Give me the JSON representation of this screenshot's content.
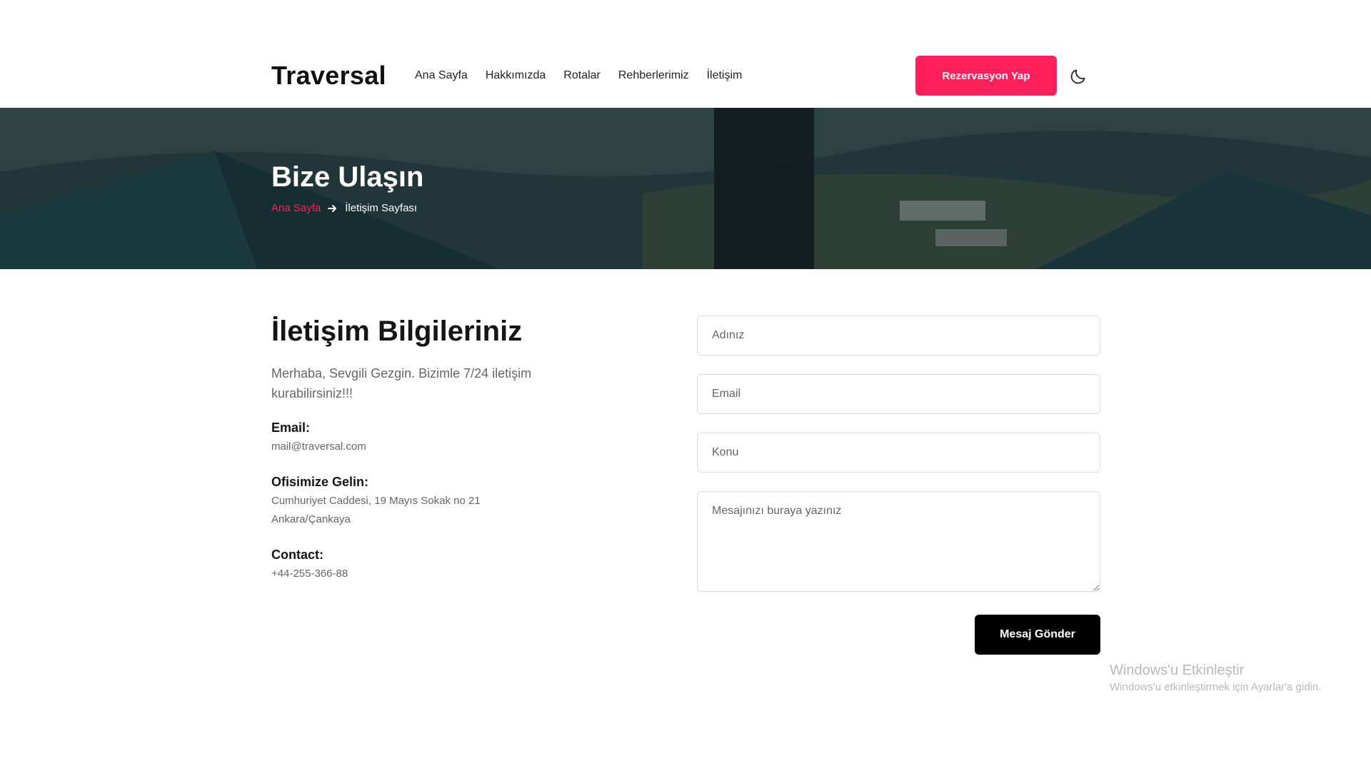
{
  "header": {
    "logo": "Traversal",
    "nav": [
      "Ana Sayfa",
      "Hakkımızda",
      "Rotalar",
      "Rehberlerimiz",
      "İletişim"
    ],
    "reserve_button": "Rezervasyon Yap",
    "theme_icon": "moon-icon"
  },
  "hero": {
    "title": "Bize Ulaşın",
    "breadcrumb": {
      "home": "Ana Sayfa",
      "separator_icon": "arrow-right-icon",
      "current": "İletişim Sayfası"
    }
  },
  "contact_info": {
    "title": "İletişim Bilgileriniz",
    "intro": "Merhaba, Sevgili Gezgin. Bizimle 7/24 iletişim kurabilirsiniz!!!",
    "email_label": "Email:",
    "email_value": "mail@traversal.com",
    "office_label": "Ofisimize Gelin:",
    "office_line1": "Cumhuriyet Caddesi, 19 Mayıs Sokak no 21",
    "office_line2": "Ankara/Çankaya",
    "contact_label": "Contact:",
    "contact_value": "+44-255-366-88"
  },
  "form": {
    "name_placeholder": "Adınız",
    "email_placeholder": "Email",
    "subject_placeholder": "Konu",
    "message_placeholder": "Mesajınızı buraya yazınız",
    "submit_label": "Mesaj Gönder"
  },
  "watermark": {
    "title": "Windows'u Etkinleştir",
    "subtitle": "Windows'u etkinleştirmek için Ayarlar'a gidin."
  },
  "colors": {
    "accent": "#ff1f5a",
    "dark": "#000000"
  }
}
